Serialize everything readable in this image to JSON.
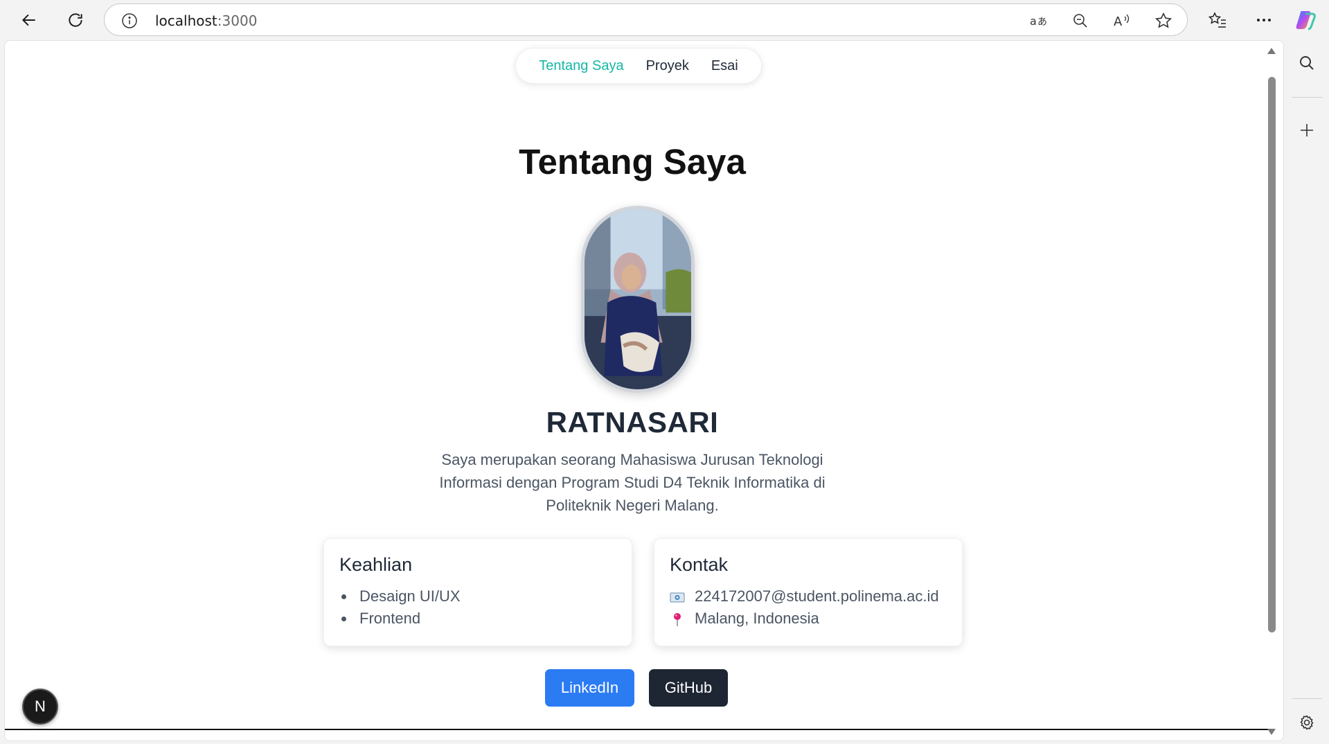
{
  "browser": {
    "url_host": "localhost",
    "url_port": ":3000"
  },
  "nav": {
    "items": [
      {
        "label": "Tentang Saya",
        "active": true
      },
      {
        "label": "Proyek",
        "active": false
      },
      {
        "label": "Esai",
        "active": false
      }
    ]
  },
  "profile": {
    "page_title": "Tentang Saya",
    "name": "RATNASARI",
    "bio": "Saya merupakan seorang Mahasiswa Jurusan Teknologi Informasi dengan Program Studi D4 Teknik Informatika di Politeknik Negeri Malang."
  },
  "skills": {
    "heading": "Keahlian",
    "items": [
      "Desaign UI/UX",
      "Frontend"
    ]
  },
  "contact": {
    "heading": "Kontak",
    "email": "224172007@student.polinema.ac.id",
    "location": "Malang, Indonesia"
  },
  "buttons": {
    "linkedin": "LinkedIn",
    "github": "GitHub"
  },
  "badge": {
    "letter": "N"
  },
  "colors": {
    "accent_teal": "#14b8a6",
    "linkedin_blue": "#2b7bf3",
    "github_dark": "#1e2533"
  }
}
